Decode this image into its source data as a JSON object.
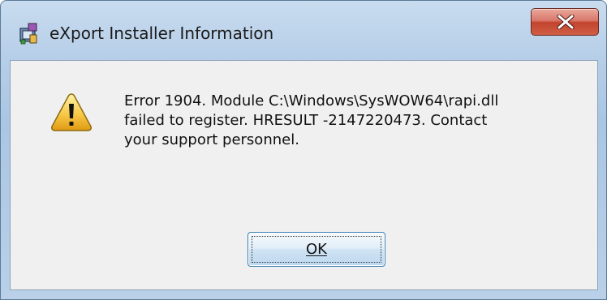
{
  "window": {
    "title": "eXport Installer Information",
    "app_icon": "installer-icon",
    "close_icon": "close-icon"
  },
  "dialog": {
    "icon": "warning-icon",
    "message_lines": [
      "Error 1904. Module C:\\Windows\\SysWOW64\\rapi.dll",
      "failed to register.  HRESULT -2147220473.  Contact",
      "your support personnel."
    ],
    "ok_label": "OK"
  },
  "colors": {
    "close_button": "#c3442f",
    "warning_fill": "#f7c948",
    "ok_border": "#3c7fb1"
  }
}
